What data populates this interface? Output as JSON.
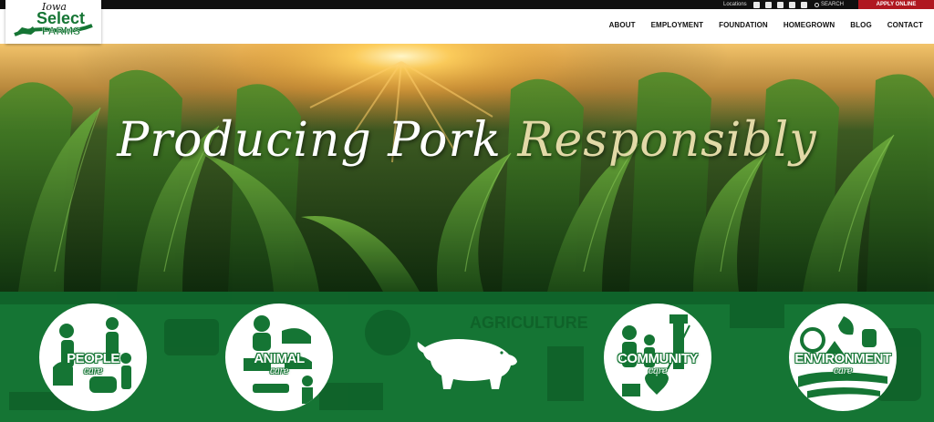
{
  "utility_bar": {
    "locations_label": "Locations",
    "social_icons": [
      "facebook-icon",
      "twitter-icon",
      "linkedin-icon",
      "instagram-icon",
      "email-icon"
    ],
    "search_label": "SEARCH",
    "apply_label": "APPLY ONLINE"
  },
  "logo": {
    "line1": "Iowa",
    "line2": "Select",
    "line3": "FARMS"
  },
  "nav": {
    "items": [
      "ABOUT",
      "EMPLOYMENT",
      "FOUNDATION",
      "HOMEGROWN",
      "BLOG",
      "CONTACT"
    ]
  },
  "hero": {
    "title_main": "Producing Pork",
    "title_accent": "Responsibly"
  },
  "care_section": {
    "items": [
      {
        "title": "PEOPLE",
        "subtitle": "care"
      },
      {
        "title": "ANIMAL",
        "subtitle": "care"
      },
      {
        "icon": "pig-icon"
      },
      {
        "title": "COMMUNITY",
        "subtitle": "care"
      },
      {
        "title": "ENVIRONMENT",
        "subtitle": "care"
      }
    ],
    "background_text": "AGRICULTURE"
  },
  "colors": {
    "brand_green": "#157534",
    "apply_red": "#b01820",
    "accent_cream": "#e2d9a7"
  }
}
